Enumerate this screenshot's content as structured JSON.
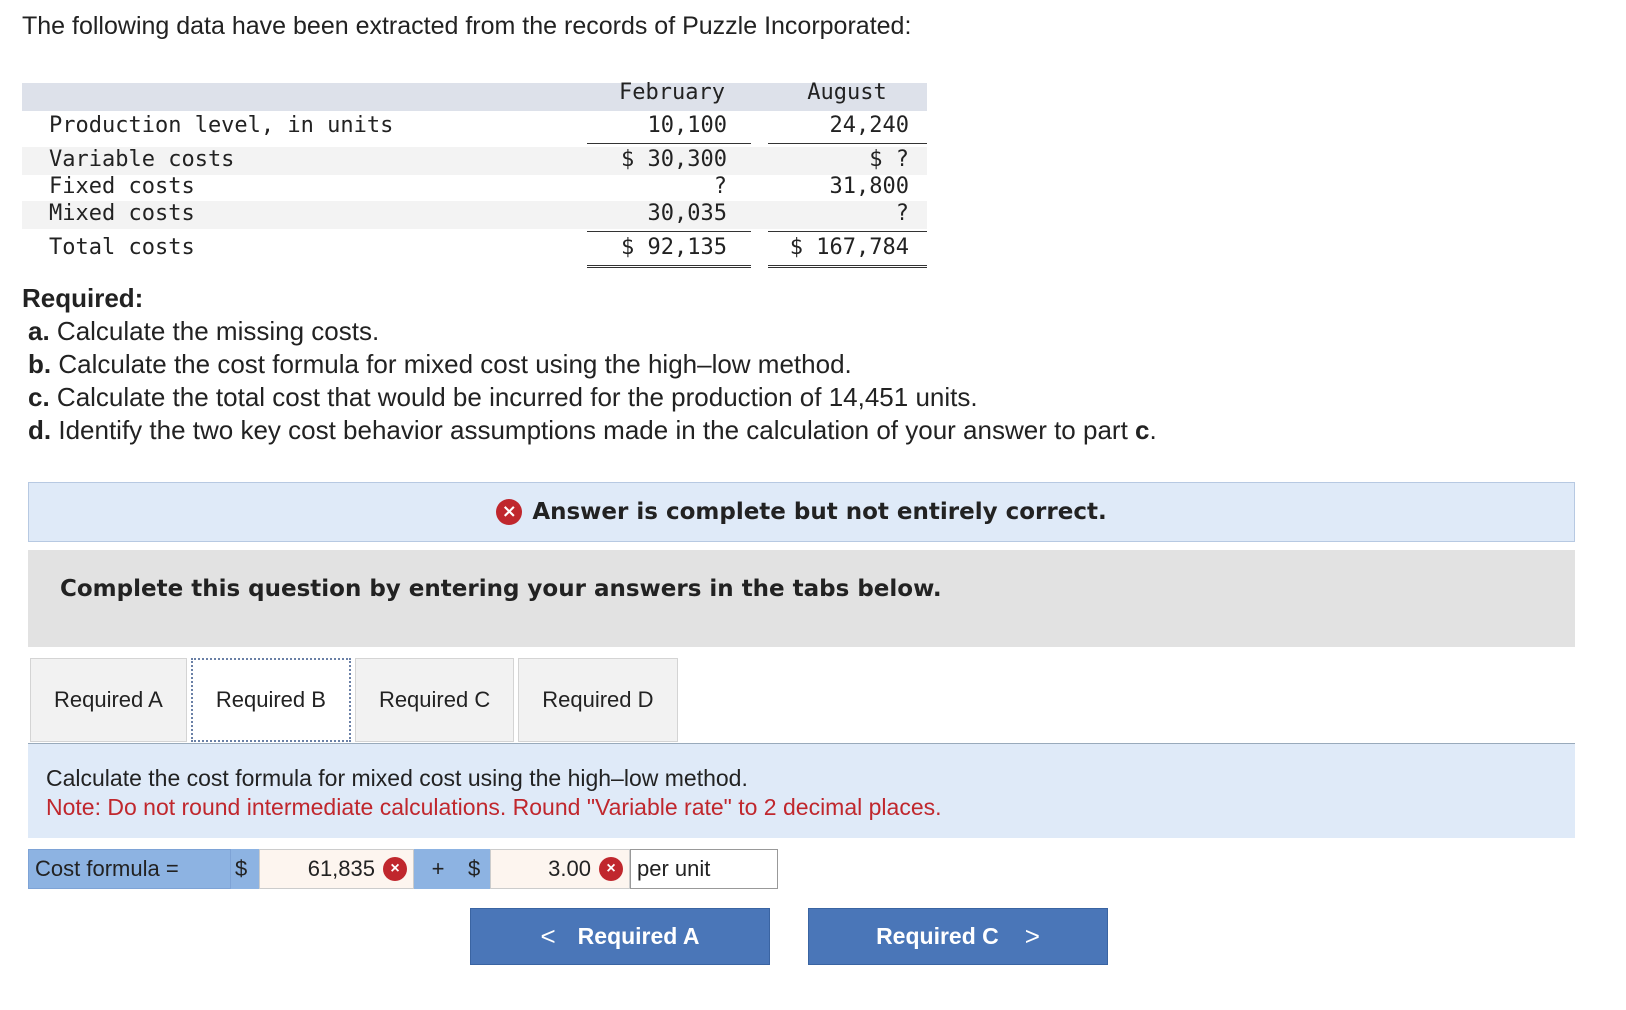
{
  "intro": "The following data have been extracted from the records of Puzzle Incorporated:",
  "table": {
    "headers": {
      "feb": "February",
      "aug": "August"
    },
    "rows": [
      {
        "label": "Production level, in units",
        "feb": "10,100",
        "aug": "24,240"
      },
      {
        "label": "Variable costs",
        "feb": "$ 30,300",
        "aug": "$ ?"
      },
      {
        "label": "Fixed costs",
        "feb": "?",
        "aug": "31,800"
      },
      {
        "label": "Mixed costs",
        "feb": "30,035",
        "aug": "?"
      },
      {
        "label": "Total costs",
        "feb": "$ 92,135",
        "aug": "$ 167,784"
      }
    ]
  },
  "required": {
    "heading": "Required:",
    "a_letter": "a.",
    "a_text": "Calculate the missing costs.",
    "b_letter": "b.",
    "b_text": "Calculate the cost formula for mixed cost using the high–low method.",
    "c_letter": "c.",
    "c_text": "Calculate the total cost that would be incurred for the production of 14,451 units.",
    "d_letter": "d.",
    "d_text_pre": "Identify the two key cost behavior assumptions made in the calculation of your answer to part ",
    "d_text_bold": "c",
    "d_text_post": "."
  },
  "banner": {
    "icon": "×",
    "text": "Answer is complete but not entirely correct."
  },
  "instruction": "Complete this question by entering your answers in the tabs below.",
  "tabs": [
    "Required A",
    "Required B",
    "Required C",
    "Required D"
  ],
  "panel": {
    "text": "Calculate the cost formula for mixed cost using the high–low method.",
    "note": "Note: Do not round intermediate calculations. Round \"Variable rate\" to 2 decimal places."
  },
  "formula": {
    "label": "Cost formula =",
    "dollar1": "$",
    "fixed_value": "61,835",
    "plus": "+",
    "dollar2": "$",
    "rate_value": "3.00",
    "per_unit": "per unit",
    "x_icon": "×"
  },
  "nav": {
    "prev_label": "Required A",
    "prev_chev": "<",
    "next_label": "Required C",
    "next_chev": ">"
  },
  "colors": {
    "error_red": "#c0272d",
    "button_blue": "#4a76b8",
    "panel_blue": "#dfeaf8"
  }
}
